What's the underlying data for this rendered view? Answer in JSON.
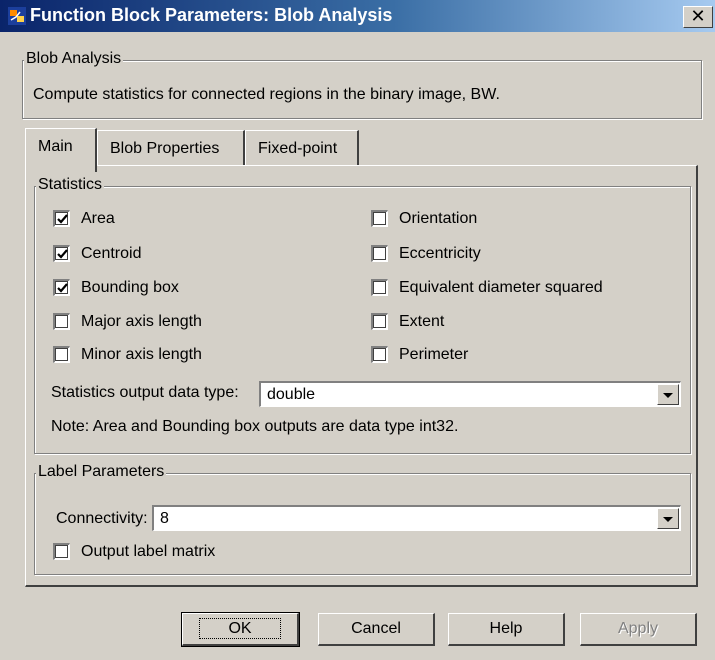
{
  "window": {
    "title": "Function Block Parameters: Blob Analysis",
    "close_glyph": "✕"
  },
  "description": {
    "group_label": "Blob Analysis",
    "text": "Compute statistics for connected regions in the binary image, BW."
  },
  "tabs": [
    {
      "label": "Main",
      "active": true
    },
    {
      "label": "Blob Properties",
      "active": false
    },
    {
      "label": "Fixed-point",
      "active": false
    }
  ],
  "statistics": {
    "group_label": "Statistics",
    "left": [
      {
        "label": "Area",
        "checked": true
      },
      {
        "label": "Centroid",
        "checked": true
      },
      {
        "label": "Bounding box",
        "checked": true
      },
      {
        "label": "Major axis length",
        "checked": false
      },
      {
        "label": "Minor axis length",
        "checked": false
      }
    ],
    "right": [
      {
        "label": "Orientation",
        "checked": false
      },
      {
        "label": "Eccentricity",
        "checked": false
      },
      {
        "label": "Equivalent diameter squared",
        "checked": false
      },
      {
        "label": "Extent",
        "checked": false
      },
      {
        "label": "Perimeter",
        "checked": false
      }
    ],
    "output_type_label": "Statistics output data type:",
    "output_type_value": "double",
    "note": "Note:  Area and Bounding box outputs are data type int32."
  },
  "label_params": {
    "group_label": "Label Parameters",
    "connectivity_label": "Connectivity:",
    "connectivity_value": "8",
    "output_label_matrix": {
      "label": "Output label matrix",
      "checked": false
    }
  },
  "buttons": {
    "ok": "OK",
    "cancel": "Cancel",
    "help": "Help",
    "apply": "Apply"
  },
  "colors": {
    "title_start": "#0a246a",
    "title_end": "#a6caf0",
    "face": "#d4d0c8"
  }
}
